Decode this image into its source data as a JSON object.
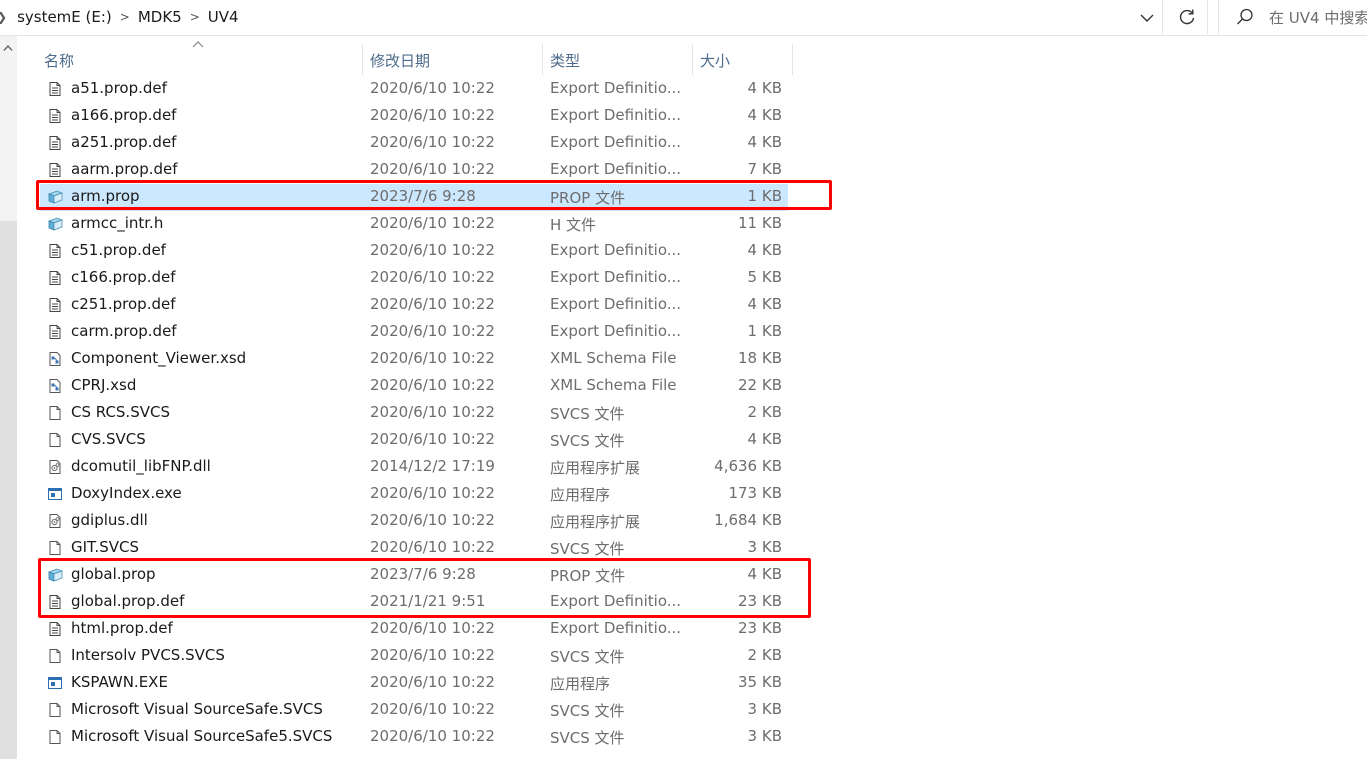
{
  "breadcrumb": {
    "items": [
      "systemE (E:)",
      "MDK5",
      "UV4"
    ],
    "separator": ">"
  },
  "search": {
    "placeholder": "在 UV4 中搜索"
  },
  "columns": {
    "name": "名称",
    "date": "修改日期",
    "type": "类型",
    "size": "大小"
  },
  "colors": {
    "selection": "#cce8ff",
    "annotation": "#ff0000",
    "header_text": "#4d6b8a"
  },
  "files": [
    {
      "name": "a51.prop.def",
      "date": "2020/6/10 10:22",
      "type": "Export Definitio...",
      "size": "4 KB",
      "icon": "text-file-icon"
    },
    {
      "name": "a166.prop.def",
      "date": "2020/6/10 10:22",
      "type": "Export Definitio...",
      "size": "4 KB",
      "icon": "text-file-icon"
    },
    {
      "name": "a251.prop.def",
      "date": "2020/6/10 10:22",
      "type": "Export Definitio...",
      "size": "4 KB",
      "icon": "text-file-icon"
    },
    {
      "name": "aarm.prop.def",
      "date": "2020/6/10 10:22",
      "type": "Export Definitio...",
      "size": "7 KB",
      "icon": "text-file-icon"
    },
    {
      "name": "arm.prop",
      "date": "2023/7/6 9:28",
      "type": "PROP 文件",
      "size": "1 KB",
      "icon": "prop-file-icon",
      "selected": true
    },
    {
      "name": "armcc_intr.h",
      "date": "2020/6/10 10:22",
      "type": "H 文件",
      "size": "11 KB",
      "icon": "prop-file-icon"
    },
    {
      "name": "c51.prop.def",
      "date": "2020/6/10 10:22",
      "type": "Export Definitio...",
      "size": "4 KB",
      "icon": "text-file-icon"
    },
    {
      "name": "c166.prop.def",
      "date": "2020/6/10 10:22",
      "type": "Export Definitio...",
      "size": "5 KB",
      "icon": "text-file-icon"
    },
    {
      "name": "c251.prop.def",
      "date": "2020/6/10 10:22",
      "type": "Export Definitio...",
      "size": "4 KB",
      "icon": "text-file-icon"
    },
    {
      "name": "carm.prop.def",
      "date": "2020/6/10 10:22",
      "type": "Export Definitio...",
      "size": "1 KB",
      "icon": "text-file-icon"
    },
    {
      "name": "Component_Viewer.xsd",
      "date": "2020/6/10 10:22",
      "type": "XML Schema File",
      "size": "18 KB",
      "icon": "xsd-file-icon"
    },
    {
      "name": "CPRJ.xsd",
      "date": "2020/6/10 10:22",
      "type": "XML Schema File",
      "size": "22 KB",
      "icon": "xsd-file-icon"
    },
    {
      "name": "CS RCS.SVCS",
      "date": "2020/6/10 10:22",
      "type": "SVCS 文件",
      "size": "2 KB",
      "icon": "blank-file-icon"
    },
    {
      "name": "CVS.SVCS",
      "date": "2020/6/10 10:22",
      "type": "SVCS 文件",
      "size": "4 KB",
      "icon": "blank-file-icon"
    },
    {
      "name": "dcomutil_libFNP.dll",
      "date": "2014/12/2 17:19",
      "type": "应用程序扩展",
      "size": "4,636 KB",
      "icon": "dll-file-icon"
    },
    {
      "name": "DoxyIndex.exe",
      "date": "2020/6/10 10:22",
      "type": "应用程序",
      "size": "173 KB",
      "icon": "exe-file-icon"
    },
    {
      "name": "gdiplus.dll",
      "date": "2020/6/10 10:22",
      "type": "应用程序扩展",
      "size": "1,684 KB",
      "icon": "dll-file-icon"
    },
    {
      "name": "GIT.SVCS",
      "date": "2020/6/10 10:22",
      "type": "SVCS 文件",
      "size": "3 KB",
      "icon": "blank-file-icon"
    },
    {
      "name": "global.prop",
      "date": "2023/7/6 9:28",
      "type": "PROP 文件",
      "size": "4 KB",
      "icon": "prop-file-icon"
    },
    {
      "name": "global.prop.def",
      "date": "2021/1/21 9:51",
      "type": "Export Definitio...",
      "size": "23 KB",
      "icon": "text-file-icon"
    },
    {
      "name": "html.prop.def",
      "date": "2020/6/10 10:22",
      "type": "Export Definitio...",
      "size": "23 KB",
      "icon": "text-file-icon"
    },
    {
      "name": "Intersolv PVCS.SVCS",
      "date": "2020/6/10 10:22",
      "type": "SVCS 文件",
      "size": "2 KB",
      "icon": "blank-file-icon"
    },
    {
      "name": "KSPAWN.EXE",
      "date": "2020/6/10 10:22",
      "type": "应用程序",
      "size": "35 KB",
      "icon": "exe-file-icon"
    },
    {
      "name": "Microsoft Visual SourceSafe.SVCS",
      "date": "2020/6/10 10:22",
      "type": "SVCS 文件",
      "size": "3 KB",
      "icon": "blank-file-icon"
    },
    {
      "name": "Microsoft Visual SourceSafe5.SVCS",
      "date": "2020/6/10 10:22",
      "type": "SVCS 文件",
      "size": "3 KB",
      "icon": "blank-file-icon"
    }
  ]
}
